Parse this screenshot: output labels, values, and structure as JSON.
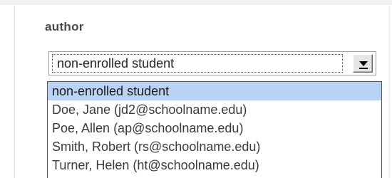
{
  "field": {
    "label": "author",
    "selected_value": "non-enrolled student",
    "arrow_icon": "chevron-down-icon"
  },
  "dropdown": {
    "options": [
      "non-enrolled student",
      "Doe, Jane (jd2@schoolname.edu)",
      "Poe, Allen (ap@schoolname.edu)",
      "Smith, Robert (rs@schoolname.edu)",
      "Turner, Helen (ht@schoolname.edu)"
    ],
    "highlighted_index": 0
  },
  "colors": {
    "highlight": "#b8d3f4",
    "label_text": "#4a4a4a",
    "option_text": "#3a3a3a"
  }
}
